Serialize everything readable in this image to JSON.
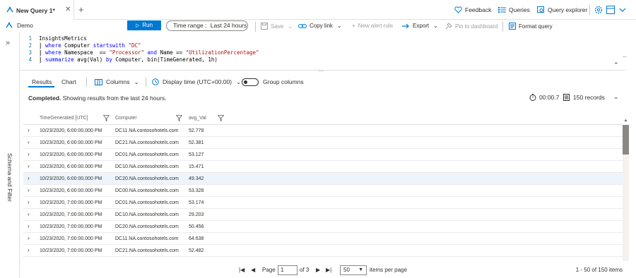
{
  "tab": {
    "title": "New Query 1*",
    "close": "✕",
    "add": "+"
  },
  "topnav": {
    "feedback": "Feedback",
    "queries": "Queries",
    "explorer": "Query explorer"
  },
  "scope": {
    "name": "Demo"
  },
  "toolbar": {
    "run": "Run",
    "time_label": "Time range :",
    "time_value": "Last 24 hours",
    "save": "Save",
    "copy_link": "Copy link",
    "new_alert": "New alert rule",
    "export": "Export",
    "pin": "Pin to dashboard",
    "format": "Format query"
  },
  "editor": {
    "line_numbers": [
      "1",
      "2",
      "3",
      "4"
    ],
    "lines": [
      [
        {
          "t": "InsightsMetrics",
          "c": ""
        }
      ],
      [
        {
          "t": "| ",
          "c": "pipe"
        },
        {
          "t": "where",
          "c": "kw"
        },
        {
          "t": " Computer ",
          "c": ""
        },
        {
          "t": "startswith",
          "c": "kw"
        },
        {
          "t": " ",
          "c": ""
        },
        {
          "t": "\"DC\"",
          "c": "str"
        }
      ],
      [
        {
          "t": "| ",
          "c": "pipe"
        },
        {
          "t": "where",
          "c": "kw"
        },
        {
          "t": " Namespace  == ",
          "c": ""
        },
        {
          "t": "\"Processor\"",
          "c": "str"
        },
        {
          "t": " ",
          "c": ""
        },
        {
          "t": "and",
          "c": "kw"
        },
        {
          "t": " Name == ",
          "c": ""
        },
        {
          "t": "\"UtilizationPercentage\"",
          "c": "str"
        }
      ],
      [
        {
          "t": "| ",
          "c": "pipe"
        },
        {
          "t": "summarize",
          "c": "kw"
        },
        {
          "t": " avg(Val) ",
          "c": ""
        },
        {
          "t": "by",
          "c": "kw"
        },
        {
          "t": " Computer, bin(TimeGenerated, 1h)",
          "c": ""
        }
      ]
    ]
  },
  "sidepanel": {
    "label": "Schema and Filter"
  },
  "results": {
    "tabs": [
      "Results",
      "Chart"
    ],
    "columns_btn": "Columns",
    "display_time": "Display time (UTC+00:00)",
    "group_columns": "Group columns",
    "status_bold": "Completed.",
    "status_text": " Showing results from the last 24 hours.",
    "elapsed": "00:00.7",
    "records": "150 records",
    "headers": [
      "TimeGenerated [UTC]",
      "Computer",
      "avg_Val"
    ],
    "rows": [
      [
        "10/23/2020, 6:00:00.000 PM",
        "DC11.NA.contosohotels.com",
        "52.778"
      ],
      [
        "10/23/2020, 6:00:00.000 PM",
        "DC21.NA.contosohotels.com",
        "52.381"
      ],
      [
        "10/23/2020, 6:00:00.000 PM",
        "DC01.NA.contosohotels.com",
        "53.127"
      ],
      [
        "10/23/2020, 6:00:00.000 PM",
        "DC10.NA.contosohotels.com",
        "15.471"
      ],
      [
        "10/23/2020, 6:00:00.000 PM",
        "DC20.NA.contosohotels.com",
        "49.342"
      ],
      [
        "10/23/2020, 6:00:00.000 PM",
        "DC00.NA.contosohotels.com",
        "53.328"
      ],
      [
        "10/23/2020, 7:00:00.000 PM",
        "DC01.NA.contosohotels.com",
        "53.174"
      ],
      [
        "10/23/2020, 7:00:00.000 PM",
        "DC10.NA.contosohotels.com",
        "29.203"
      ],
      [
        "10/23/2020, 7:00:00.000 PM",
        "DC20.NA.contosohotels.com",
        "50.456"
      ],
      [
        "10/23/2020, 7:00:00.000 PM",
        "DC11.NA.contosohotels.com",
        "64.638"
      ],
      [
        "10/23/2020, 7:00:00.000 PM",
        "DC21.NA.contosohotels.com",
        "52.482"
      ]
    ],
    "selected_row": 4
  },
  "pager": {
    "page_label": "Page",
    "page_value": "1",
    "of_label": "of 3",
    "page_size": "50",
    "items_per_page": "items per page",
    "range": "1 - 50 of 150 items"
  }
}
